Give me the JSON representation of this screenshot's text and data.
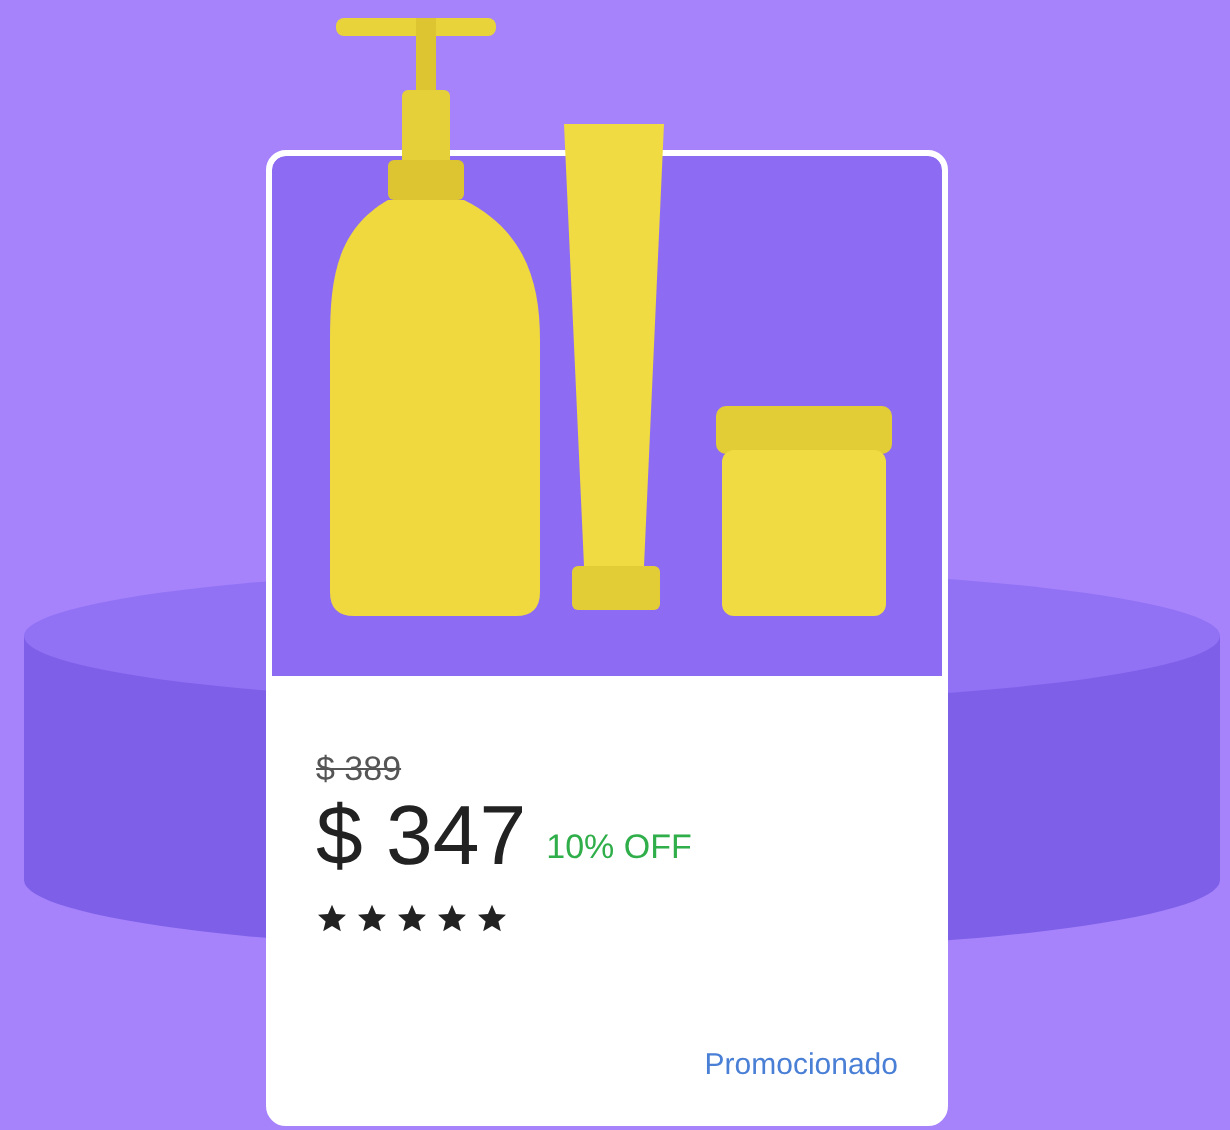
{
  "product_card": {
    "original_price": "$ 389",
    "price": "$ 347",
    "discount": "10% OFF",
    "stars": 5,
    "label": "Promocionado"
  }
}
